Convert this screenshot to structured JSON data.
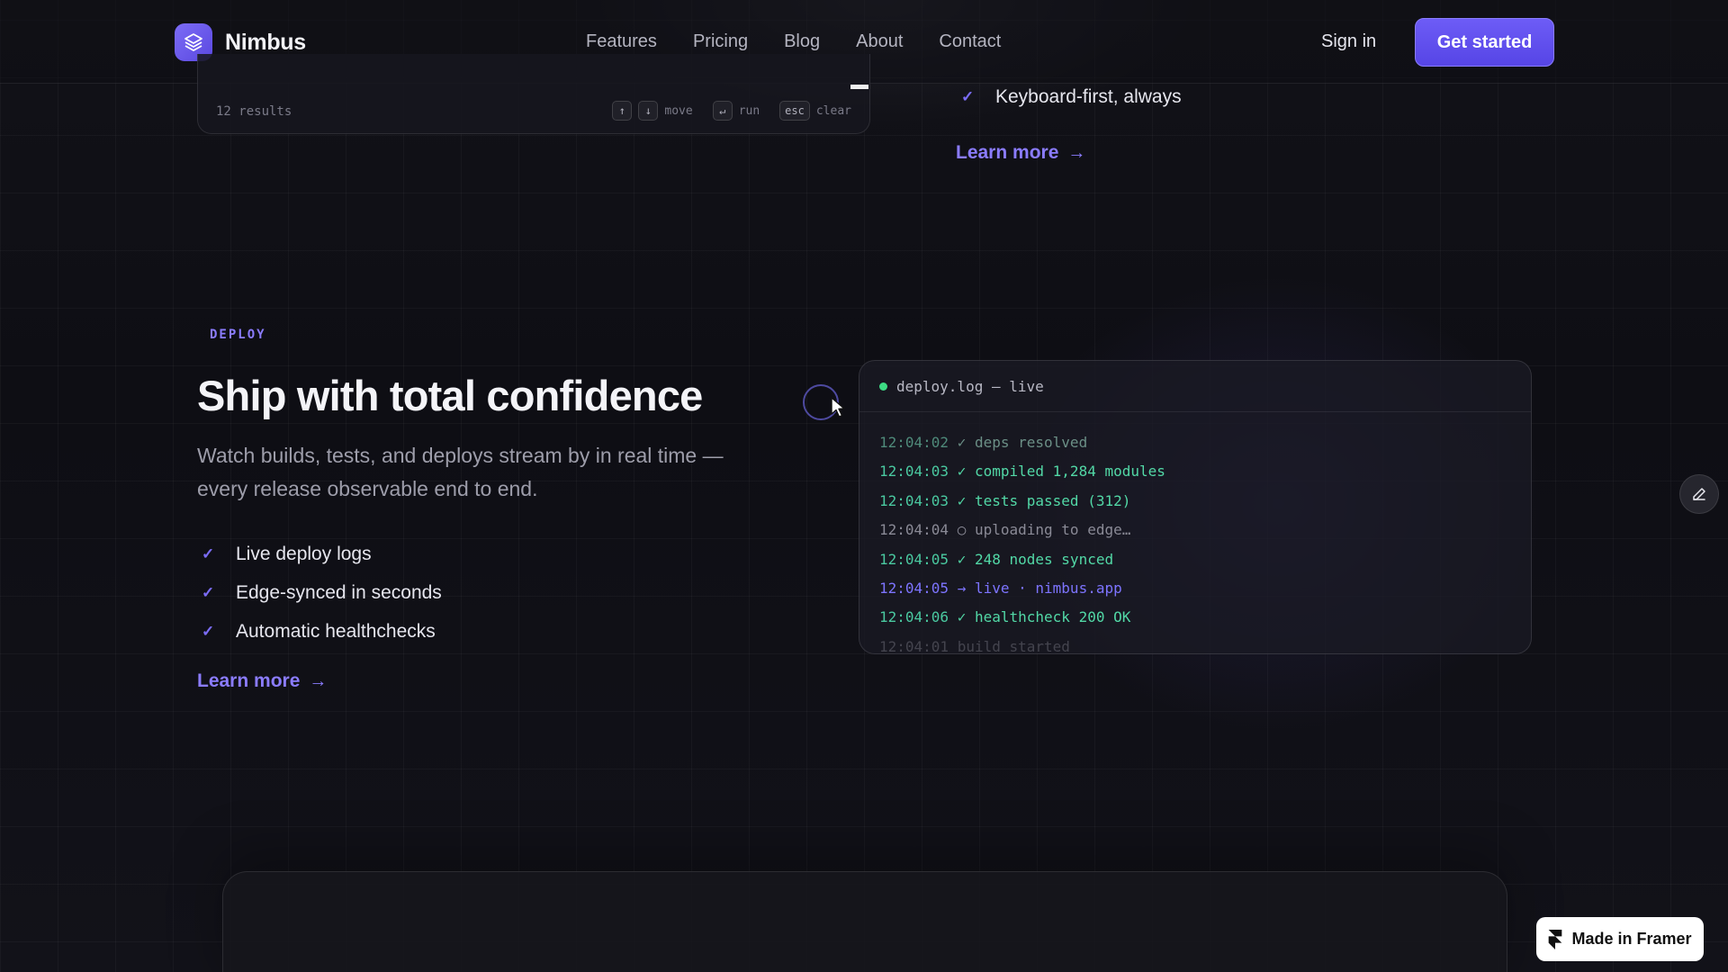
{
  "brand": {
    "name": "Nimbus",
    "logo_icon": "layers-icon",
    "accent": "#6d5cf6"
  },
  "nav": {
    "links": [
      "Features",
      "Pricing",
      "Blog",
      "About",
      "Contact"
    ],
    "sign_in": "Sign in",
    "cta": "Get started"
  },
  "command_panel": {
    "results": "12 results",
    "keys": {
      "up": "↑",
      "down": "↓",
      "move": "move",
      "enter": "↵",
      "run": "run",
      "esc": "esc",
      "clear": "clear"
    }
  },
  "prev_section": {
    "feature": "Keyboard-first, always",
    "learn_more": "Learn more",
    "arrow": "→"
  },
  "deploy_section": {
    "eyebrow": "DEPLOY",
    "headline": "Ship with total confidence",
    "description": "Watch builds, tests, and deploys stream by in real time — every release observable end to end.",
    "features": [
      "Live deploy logs",
      "Edge-synced in seconds",
      "Automatic healthchecks"
    ],
    "check": "✓",
    "learn_more": "Learn more",
    "arrow": "→"
  },
  "deploy_log": {
    "title": "deploy.log — live",
    "status_color": "#3ddc84",
    "lines": [
      {
        "time": "12:04:02",
        "text": "✓ deps resolved"
      },
      {
        "time": "12:04:03",
        "text": "✓ compiled 1,284 modules"
      },
      {
        "time": "12:04:03",
        "text": "✓ tests passed (312)"
      },
      {
        "time": "12:04:04",
        "text": "○ uploading to edge…"
      },
      {
        "time": "12:04:05",
        "text": "✓ 248 nodes synced"
      },
      {
        "time": "12:04:05",
        "text": "→ live · nimbus.app"
      },
      {
        "time": "12:04:06",
        "text": "✓ healthcheck 200 OK"
      },
      {
        "time": "12:04:01",
        "text": "build started"
      }
    ]
  },
  "framer_badge": {
    "label": "Made in Framer",
    "icon": "framer-icon"
  },
  "edit_button": {
    "icon": "pencil-icon"
  }
}
